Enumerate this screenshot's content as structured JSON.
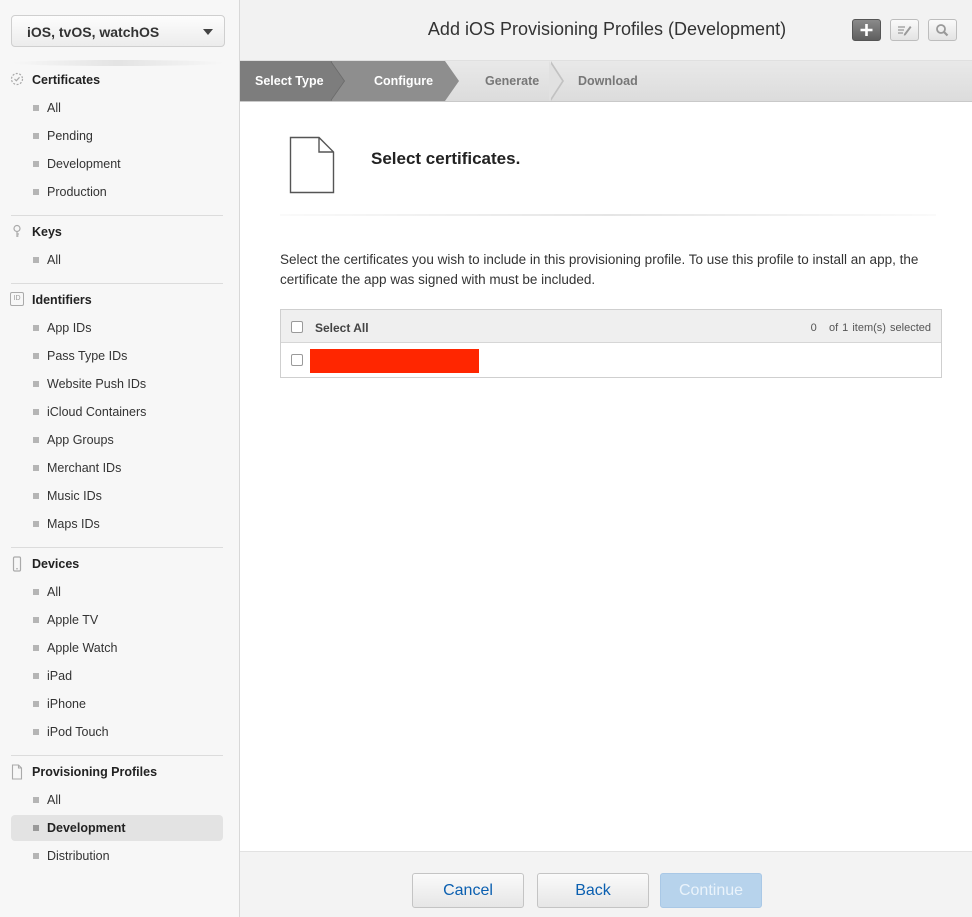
{
  "platform_select": {
    "value": "iOS, tvOS, watchOS"
  },
  "header": {
    "title": "Add iOS Provisioning Profiles (Development)"
  },
  "toolbar": {
    "add_icon": "plus-icon",
    "edit_icon": "edit-icon",
    "search_icon": "search-icon"
  },
  "steps": [
    "Select Type",
    "Configure",
    "Generate",
    "Download"
  ],
  "sidebar": {
    "certificates": {
      "title": "Certificates",
      "items": [
        "All",
        "Pending",
        "Development",
        "Production"
      ]
    },
    "keys": {
      "title": "Keys",
      "items": [
        "All"
      ]
    },
    "identifiers": {
      "title": "Identifiers",
      "icon_text": "ID",
      "items": [
        "App IDs",
        "Pass Type IDs",
        "Website Push IDs",
        "iCloud Containers",
        "App Groups",
        "Merchant IDs",
        "Music IDs",
        "Maps IDs"
      ]
    },
    "devices": {
      "title": "Devices",
      "items": [
        "All",
        "Apple TV",
        "Apple Watch",
        "iPad",
        "iPhone",
        "iPod Touch"
      ]
    },
    "profiles": {
      "title": "Provisioning Profiles",
      "items": [
        "All",
        "Development",
        "Distribution"
      ],
      "active": "Development"
    }
  },
  "main": {
    "section_title": "Select certificates.",
    "description": "Select the certificates you wish to include in this provisioning profile. To use this profile to install an app, the certificate the app was signed with must be included.",
    "select_all_label": "Select All",
    "selected_count": "0",
    "selected_suffix": "of 1 item(s) selected",
    "redaction_color": "#ff2600"
  },
  "footer": {
    "cancel": "Cancel",
    "back": "Back",
    "continue": "Continue"
  },
  "colors": {
    "link_blue": "#0a5fb0",
    "continue_disabled": "#b7d3ec",
    "step_done": "#7d7d7d"
  }
}
